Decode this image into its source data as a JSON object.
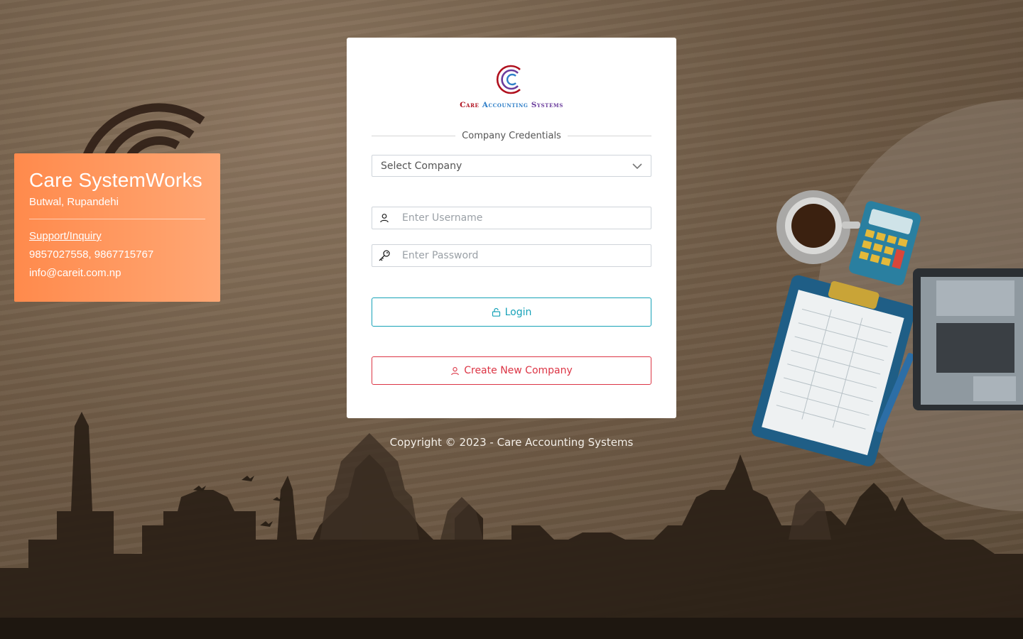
{
  "info_card": {
    "company_name": "Care SystemWorks",
    "location": "Butwal, Rupandehi",
    "support_label": "Support/Inquiry",
    "phones": "9857027558, 9867715767",
    "email": "info@careit.com.np"
  },
  "logo": {
    "word1": "Care",
    "word2": "Accounting",
    "word3": "Systems"
  },
  "login": {
    "section_heading": "Company Credentials",
    "company_select": "Select Company",
    "username_placeholder": "Enter Username",
    "password_placeholder": "Enter Password",
    "login_label": "Login",
    "create_label": "Create New Company"
  },
  "footer": {
    "copyright": "Copyright © 2023 - Care Accounting Systems"
  },
  "colors": {
    "info_card_start": "#ff8a4c",
    "info_card_end": "#ffa774",
    "login_accent": "#17a2b8",
    "create_accent": "#dc3545"
  },
  "icons": {
    "user": "user-icon",
    "password": "key-icon",
    "login": "unlock-icon",
    "create": "user-icon",
    "select": "chevron-down-icon"
  }
}
